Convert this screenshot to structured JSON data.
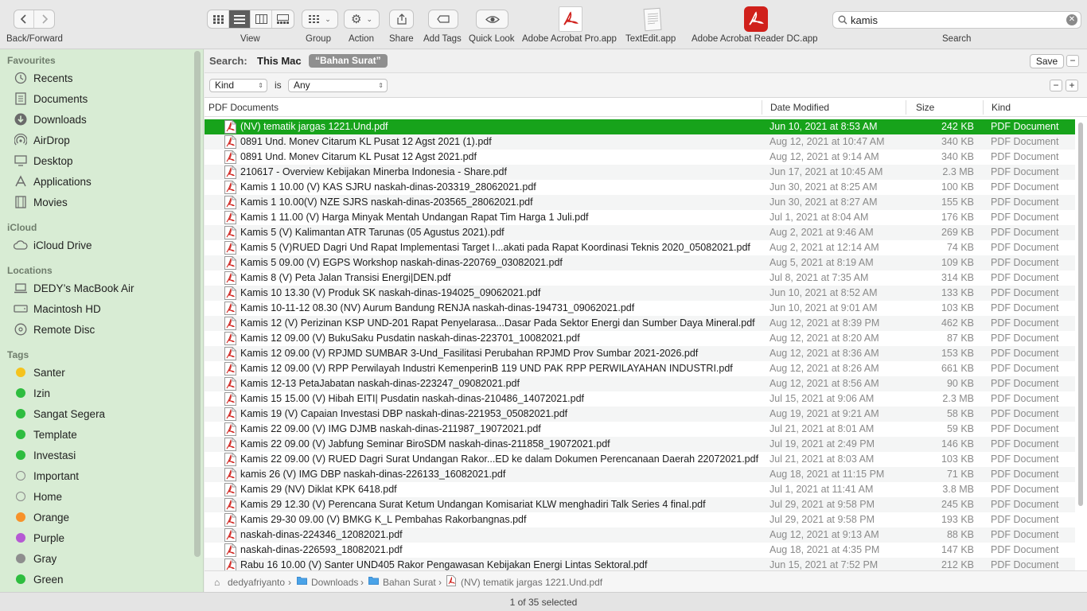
{
  "toolbar": {
    "back_forward_label": "Back/Forward",
    "view_label": "View",
    "group_label": "Group",
    "action_label": "Action",
    "share_label": "Share",
    "add_tags_label": "Add Tags",
    "quick_look_label": "Quick Look",
    "app1_label": "Adobe Acrobat Pro.app",
    "app2_label": "TextEdit.app",
    "app3_label": "Adobe Acrobat Reader DC.app",
    "search_label": "Search",
    "search_value": "kamis"
  },
  "sidebar": {
    "favourites_heading": "Favourites",
    "favourites": [
      {
        "label": "Recents",
        "icon": "clock-icon"
      },
      {
        "label": "Documents",
        "icon": "document-icon"
      },
      {
        "label": "Downloads",
        "icon": "download-icon"
      },
      {
        "label": "AirDrop",
        "icon": "airdrop-icon"
      },
      {
        "label": "Desktop",
        "icon": "desktop-icon"
      },
      {
        "label": "Applications",
        "icon": "applications-icon"
      },
      {
        "label": "Movies",
        "icon": "film-icon"
      }
    ],
    "icloud_heading": "iCloud",
    "icloud": [
      {
        "label": "iCloud Drive",
        "icon": "cloud-icon"
      }
    ],
    "locations_heading": "Locations",
    "locations": [
      {
        "label": "DEDY’s MacBook Air",
        "icon": "laptop-icon"
      },
      {
        "label": "Macintosh HD",
        "icon": "harddisk-icon"
      },
      {
        "label": "Remote Disc",
        "icon": "disc-icon"
      }
    ],
    "tags_heading": "Tags",
    "tags": [
      {
        "label": "Santer",
        "color": "#f5c31d"
      },
      {
        "label": "Izin",
        "color": "#2ebd3f"
      },
      {
        "label": "Sangat Segera",
        "color": "#2ebd3f"
      },
      {
        "label": "Template",
        "color": "#2ebd3f"
      },
      {
        "label": "Investasi",
        "color": "#2ebd3f"
      },
      {
        "label": "Important",
        "color": "none"
      },
      {
        "label": "Home",
        "color": "none"
      },
      {
        "label": "Orange",
        "color": "#f7922a"
      },
      {
        "label": "Purple",
        "color": "#b559d3"
      },
      {
        "label": "Gray",
        "color": "#8e8e8e"
      },
      {
        "label": "Green",
        "color": "#2ebd3f"
      }
    ]
  },
  "scope": {
    "search_label": "Search:",
    "this_mac": "This Mac",
    "folder_token": "“Bahan Surat”",
    "save_label": "Save",
    "remove_label": "−"
  },
  "criteria": {
    "kind_value": "Kind",
    "is_label": "is",
    "any_value": "Any",
    "minus_label": "−",
    "plus_label": "+"
  },
  "columns": {
    "name": "PDF Documents",
    "date": "Date Modified",
    "size": "Size",
    "kind": "Kind"
  },
  "files": [
    {
      "name": "(NV) tematik  jargas 1221.Und.pdf",
      "date": "Jun 10, 2021 at 8:53 AM",
      "size": "242 KB",
      "kind": "PDF Document"
    },
    {
      "name": "0891 Und. Monev Citarum KL Pusat 12 Agst  2021 (1).pdf",
      "date": "Aug 12, 2021 at 10:47 AM",
      "size": "340 KB",
      "kind": "PDF Document"
    },
    {
      "name": "0891 Und. Monev Citarum KL Pusat 12 Agst  2021.pdf",
      "date": "Aug 12, 2021 at 9:14 AM",
      "size": "340 KB",
      "kind": "PDF Document"
    },
    {
      "name": "210617 - Overview Kebijakan Minerba Indonesia - Share.pdf",
      "date": "Jun 17, 2021 at 10:45 AM",
      "size": "2.3 MB",
      "kind": "PDF Document"
    },
    {
      "name": "Kamis 1 10.00 (V) KAS SJRU naskah-dinas-203319_28062021.pdf",
      "date": "Jun 30, 2021 at 8:25 AM",
      "size": "100 KB",
      "kind": "PDF Document"
    },
    {
      "name": "Kamis 1 10.00(V) NZE SJRS naskah-dinas-203565_28062021.pdf",
      "date": "Jun 30, 2021 at 8:27 AM",
      "size": "155 KB",
      "kind": "PDF Document"
    },
    {
      "name": "Kamis 1 11.00 (V) Harga Minyak Mentah Undangan Rapat Tim Harga 1 Juli.pdf",
      "date": "Jul 1, 2021 at 8:04 AM",
      "size": "176 KB",
      "kind": "PDF Document"
    },
    {
      "name": "Kamis 5 (V) Kalimantan ATR Tarunas (05 Agustus 2021).pdf",
      "date": "Aug 2, 2021 at 9:46 AM",
      "size": "269 KB",
      "kind": "PDF Document"
    },
    {
      "name": "Kamis 5 (V)RUED Dagri Und Rapat Implementasi Target I...akati pada Rapat Koordinasi Teknis 2020_05082021.pdf",
      "date": "Aug 2, 2021 at 12:14 AM",
      "size": "74 KB",
      "kind": "PDF Document"
    },
    {
      "name": "Kamis 5 09.00 (V) EGPS Workshop naskah-dinas-220769_03082021.pdf",
      "date": "Aug 5, 2021 at 8:19 AM",
      "size": "109 KB",
      "kind": "PDF Document"
    },
    {
      "name": "Kamis 8 (V) Peta Jalan Transisi Energi|DEN.pdf",
      "date": "Jul 8, 2021 at 7:35 AM",
      "size": "314 KB",
      "kind": "PDF Document"
    },
    {
      "name": "Kamis 10 13.30 (V) Produk SK naskah-dinas-194025_09062021.pdf",
      "date": "Jun 10, 2021 at 8:52 AM",
      "size": "133 KB",
      "kind": "PDF Document"
    },
    {
      "name": "Kamis 10-11-12 08.30 (NV) Aurum Bandung RENJA naskah-dinas-194731_09062021.pdf",
      "date": "Jun 10, 2021 at 9:01 AM",
      "size": "103 KB",
      "kind": "PDF Document"
    },
    {
      "name": "Kamis 12 (V) Perizinan KSP UND-201 Rapat Penyelarasa...Dasar Pada Sektor Energi dan Sumber Daya Mineral.pdf",
      "date": "Aug 12, 2021 at 8:39 PM",
      "size": "462 KB",
      "kind": "PDF Document"
    },
    {
      "name": "Kamis 12 09.00 (V) BukuSaku Pusdatin naskah-dinas-223701_10082021.pdf",
      "date": "Aug 12, 2021 at 8:20 AM",
      "size": "87 KB",
      "kind": "PDF Document"
    },
    {
      "name": "Kamis 12 09.00 (V) RPJMD SUMBAR 3-Und_Fasilitasi Perubahan RPJMD Prov Sumbar 2021-2026.pdf",
      "date": "Aug 12, 2021 at 8:36 AM",
      "size": "153 KB",
      "kind": "PDF Document"
    },
    {
      "name": "Kamis 12 09.00 (V) RPP Perwilayah Industri KemenperinB 119 UND PAK RPP PERWILAYAHAN INDUSTRI.pdf",
      "date": "Aug 12, 2021 at 8:26 AM",
      "size": "661 KB",
      "kind": "PDF Document"
    },
    {
      "name": "Kamis 12-13 PetaJabatan naskah-dinas-223247_09082021.pdf",
      "date": "Aug 12, 2021 at 8:56 AM",
      "size": "90 KB",
      "kind": "PDF Document"
    },
    {
      "name": "Kamis 15 15.00 (V) Hibah EITI| Pusdatin naskah-dinas-210486_14072021.pdf",
      "date": "Jul 15, 2021 at 9:06 AM",
      "size": "2.3 MB",
      "kind": "PDF Document"
    },
    {
      "name": "Kamis 19 (V) Capaian Investasi DBP naskah-dinas-221953_05082021.pdf",
      "date": "Aug 19, 2021 at 9:21 AM",
      "size": "58 KB",
      "kind": "PDF Document"
    },
    {
      "name": "Kamis 22 09.00 (V) IMG DJMB naskah-dinas-211987_19072021.pdf",
      "date": "Jul 21, 2021 at 8:01 AM",
      "size": "59 KB",
      "kind": "PDF Document"
    },
    {
      "name": "Kamis 22 09.00 (V) Jabfung Seminar BiroSDM naskah-dinas-211858_19072021.pdf",
      "date": "Jul 19, 2021 at 2:49 PM",
      "size": "146 KB",
      "kind": "PDF Document"
    },
    {
      "name": "Kamis 22 09.00 (V) RUED Dagri Surat Undangan Rakor...ED ke dalam Dokumen Perencanaan Daerah 22072021.pdf",
      "date": "Jul 21, 2021 at 8:03 AM",
      "size": "103 KB",
      "kind": "PDF Document"
    },
    {
      "name": "kamis 26 (V) IMG DBP naskah-dinas-226133_16082021.pdf",
      "date": "Aug 18, 2021 at 11:15 PM",
      "size": "71 KB",
      "kind": "PDF Document"
    },
    {
      "name": "Kamis 29 (NV) Diklat KPK 6418.pdf",
      "date": "Jul 1, 2021 at 11:41 AM",
      "size": "3.8 MB",
      "kind": "PDF Document"
    },
    {
      "name": "Kamis 29 12.30 (V) Perencana Surat Ketum  Undangan Komisariat KLW menghadiri Talk Series 4 final.pdf",
      "date": "Jul 29, 2021 at 9:58 PM",
      "size": "245 KB",
      "kind": "PDF Document"
    },
    {
      "name": "Kamis 29-30 09.00 (V) BMKG K_L Pembahas Rakorbangnas.pdf",
      "date": "Jul 29, 2021 at 9:58 PM",
      "size": "193 KB",
      "kind": "PDF Document"
    },
    {
      "name": "naskah-dinas-224346_12082021.pdf",
      "date": "Aug 12, 2021 at 9:13 AM",
      "size": "88 KB",
      "kind": "PDF Document"
    },
    {
      "name": "naskah-dinas-226593_18082021.pdf",
      "date": "Aug 18, 2021 at 4:35 PM",
      "size": "147 KB",
      "kind": "PDF Document"
    },
    {
      "name": "Rabu 16 10.00 (V) Santer UND405 Rakor Pengawasan Kebijakan Energi Lintas Sektoral.pdf",
      "date": "Jun 15, 2021 at 7:52 PM",
      "size": "212 KB",
      "kind": "PDF Document"
    }
  ],
  "path": {
    "p1": "dedyafriyanto",
    "p2": "Downloads",
    "p3": "Bahan Surat",
    "p4": "(NV) tematik  jargas 1221.Und.pdf"
  },
  "status": {
    "text": "1 of 35 selected"
  },
  "colors": {
    "selection": "#17a31b",
    "sidebar_bg": "#d8ecd4",
    "pdf_red": "#d0201b"
  }
}
